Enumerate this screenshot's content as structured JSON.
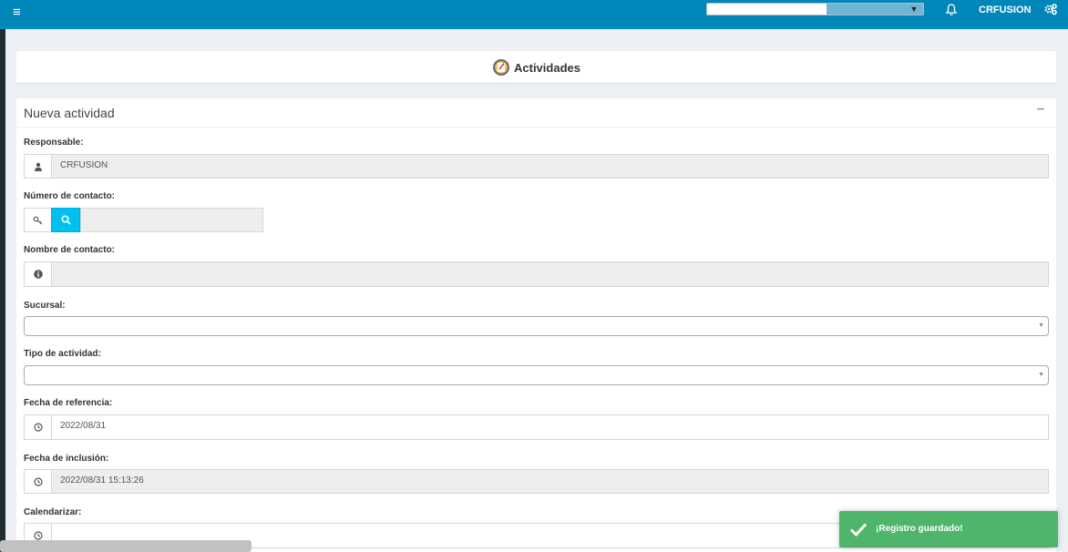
{
  "topbar": {
    "username": "CRFUSION"
  },
  "page": {
    "title": "Actividades"
  },
  "panel": {
    "title": "Nueva actividad",
    "collapse_symbol": "−"
  },
  "form": {
    "responsable": {
      "label": "Responsable:",
      "value": "CRFUSION",
      "icon": "user-icon"
    },
    "numero_contacto": {
      "label": "Número de contacto:",
      "value": "",
      "icon": "key-icon"
    },
    "nombre_contacto": {
      "label": "Nombre de contacto:",
      "value": "",
      "icon": "info-icon"
    },
    "sucursal": {
      "label": "Sucursal:",
      "value": ""
    },
    "tipo_actividad": {
      "label": "Tipo de actividad:",
      "value": ""
    },
    "fecha_referencia": {
      "label": "Fecha de referencia:",
      "value": "2022/08/31",
      "icon": "clock-icon"
    },
    "fecha_inclusion": {
      "label": "Fecha de inclusión:",
      "value": "2022/08/31 15:13:26",
      "icon": "clock-icon"
    },
    "calendarizar": {
      "label": "Calendarizar:",
      "value": "",
      "icon": "clock-icon"
    }
  },
  "toast": {
    "message": "¡Registro guardado!",
    "icon": "check-icon"
  },
  "colors": {
    "topbar": "#0087b9",
    "search_button": "#00c0ef",
    "toast": "#4fb56a"
  }
}
